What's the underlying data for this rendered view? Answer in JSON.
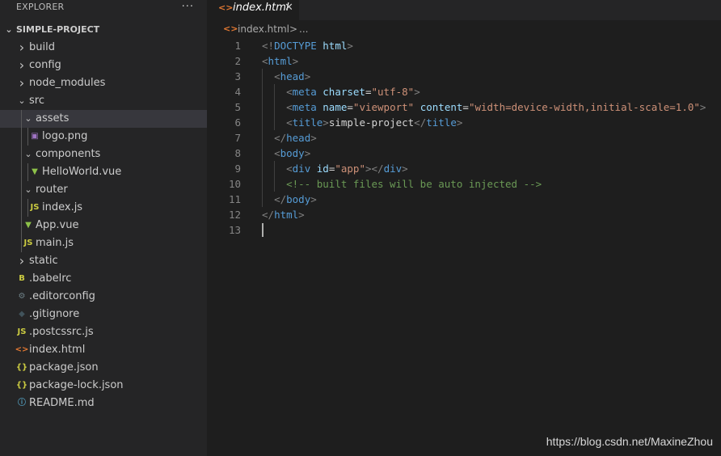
{
  "sidebar": {
    "title": "EXPLORER",
    "more": "···",
    "root": "SIMPLE-PROJECT",
    "items": [
      {
        "label": "build",
        "kind": "folder",
        "expanded": false,
        "depth": 0,
        "icon": "chevron-right-icon"
      },
      {
        "label": "config",
        "kind": "folder",
        "expanded": false,
        "depth": 0,
        "icon": "chevron-right-icon"
      },
      {
        "label": "node_modules",
        "kind": "folder",
        "expanded": false,
        "depth": 0,
        "icon": "chevron-right-icon"
      },
      {
        "label": "src",
        "kind": "folder",
        "expanded": true,
        "depth": 0,
        "icon": "chevron-down-icon"
      },
      {
        "label": "assets",
        "kind": "folder",
        "expanded": true,
        "depth": 1,
        "selected": true,
        "icon": "chevron-down-icon"
      },
      {
        "label": "logo.png",
        "kind": "file",
        "depth": 2,
        "icon": "image-file-icon",
        "color": "#a074c4"
      },
      {
        "label": "components",
        "kind": "folder",
        "expanded": true,
        "depth": 1,
        "icon": "chevron-down-icon"
      },
      {
        "label": "HelloWorld.vue",
        "kind": "file",
        "depth": 2,
        "icon": "vue-file-icon",
        "color": "#8dc149"
      },
      {
        "label": "router",
        "kind": "folder",
        "expanded": true,
        "depth": 1,
        "icon": "chevron-down-icon"
      },
      {
        "label": "index.js",
        "kind": "file",
        "depth": 2,
        "icon": "js-file-icon",
        "color": "#cbcb41"
      },
      {
        "label": "App.vue",
        "kind": "file",
        "depth": 1,
        "icon": "vue-file-icon",
        "color": "#8dc149"
      },
      {
        "label": "main.js",
        "kind": "file",
        "depth": 1,
        "icon": "js-file-icon",
        "color": "#cbcb41"
      },
      {
        "label": "static",
        "kind": "folder",
        "expanded": false,
        "depth": 0,
        "icon": "chevron-right-icon"
      },
      {
        "label": ".babelrc",
        "kind": "file",
        "depth": 0,
        "icon": "babel-file-icon",
        "color": "#cbcb41"
      },
      {
        "label": ".editorconfig",
        "kind": "file",
        "depth": 0,
        "icon": "gear-file-icon",
        "color": "#6d8086"
      },
      {
        "label": ".gitignore",
        "kind": "file",
        "depth": 0,
        "icon": "git-file-icon",
        "color": "#41535b"
      },
      {
        "label": ".postcssrc.js",
        "kind": "file",
        "depth": 0,
        "icon": "js-file-icon",
        "color": "#cbcb41"
      },
      {
        "label": "index.html",
        "kind": "file",
        "depth": 0,
        "icon": "html-file-icon",
        "color": "#e37933"
      },
      {
        "label": "package.json",
        "kind": "file",
        "depth": 0,
        "icon": "json-file-icon",
        "color": "#cbcb41"
      },
      {
        "label": "package-lock.json",
        "kind": "file",
        "depth": 0,
        "icon": "json-file-icon",
        "color": "#cbcb41"
      },
      {
        "label": "README.md",
        "kind": "file",
        "depth": 0,
        "icon": "info-file-icon",
        "color": "#519aba"
      }
    ]
  },
  "editor": {
    "tab": {
      "label": "index.html",
      "icon": "<>",
      "close": "✕"
    },
    "breadcrumb": {
      "icon": "<>",
      "file": "index.html",
      "sep": ">",
      "more": "..."
    },
    "lines": [
      [
        [
          "c-br",
          "<!"
        ],
        [
          "c-tag",
          "DOCTYPE"
        ],
        [
          "c-text",
          " "
        ],
        [
          "c-attr",
          "html"
        ],
        [
          "c-br",
          ">"
        ]
      ],
      [
        [
          "c-br",
          "<"
        ],
        [
          "c-tag",
          "html"
        ],
        [
          "c-br",
          ">"
        ]
      ],
      [
        [
          "c-text",
          "  "
        ],
        [
          "c-br",
          "<"
        ],
        [
          "c-tag",
          "head"
        ],
        [
          "c-br",
          ">"
        ]
      ],
      [
        [
          "c-text",
          "    "
        ],
        [
          "c-br",
          "<"
        ],
        [
          "c-tag",
          "meta"
        ],
        [
          "c-text",
          " "
        ],
        [
          "c-attr",
          "charset"
        ],
        [
          "c-text",
          "="
        ],
        [
          "c-str",
          "\"utf-8\""
        ],
        [
          "c-br",
          ">"
        ]
      ],
      [
        [
          "c-text",
          "    "
        ],
        [
          "c-br",
          "<"
        ],
        [
          "c-tag",
          "meta"
        ],
        [
          "c-text",
          " "
        ],
        [
          "c-attr",
          "name"
        ],
        [
          "c-text",
          "="
        ],
        [
          "c-str",
          "\"viewport\""
        ],
        [
          "c-text",
          " "
        ],
        [
          "c-attr",
          "content"
        ],
        [
          "c-text",
          "="
        ],
        [
          "c-str",
          "\"width=device-width,initial-scale=1.0\""
        ],
        [
          "c-br",
          ">"
        ]
      ],
      [
        [
          "c-text",
          "    "
        ],
        [
          "c-br",
          "<"
        ],
        [
          "c-tag",
          "title"
        ],
        [
          "c-br",
          ">"
        ],
        [
          "c-text",
          "simple-project"
        ],
        [
          "c-br",
          "</"
        ],
        [
          "c-tag",
          "title"
        ],
        [
          "c-br",
          ">"
        ]
      ],
      [
        [
          "c-text",
          "  "
        ],
        [
          "c-br",
          "</"
        ],
        [
          "c-tag",
          "head"
        ],
        [
          "c-br",
          ">"
        ]
      ],
      [
        [
          "c-text",
          "  "
        ],
        [
          "c-br",
          "<"
        ],
        [
          "c-tag",
          "body"
        ],
        [
          "c-br",
          ">"
        ]
      ],
      [
        [
          "c-text",
          "    "
        ],
        [
          "c-br",
          "<"
        ],
        [
          "c-tag",
          "div"
        ],
        [
          "c-text",
          " "
        ],
        [
          "c-attr",
          "id"
        ],
        [
          "c-text",
          "="
        ],
        [
          "c-str",
          "\"app\""
        ],
        [
          "c-br",
          "></"
        ],
        [
          "c-tag",
          "div"
        ],
        [
          "c-br",
          ">"
        ]
      ],
      [
        [
          "c-text",
          "    "
        ],
        [
          "c-com",
          "<!-- built files will be auto injected -->"
        ]
      ],
      [
        [
          "c-text",
          "  "
        ],
        [
          "c-br",
          "</"
        ],
        [
          "c-tag",
          "body"
        ],
        [
          "c-br",
          ">"
        ]
      ],
      [
        [
          "c-br",
          "</"
        ],
        [
          "c-tag",
          "html"
        ],
        [
          "c-br",
          ">"
        ]
      ],
      []
    ],
    "cursor_line": 13
  },
  "watermark": "https://blog.csdn.net/MaxineZhou"
}
